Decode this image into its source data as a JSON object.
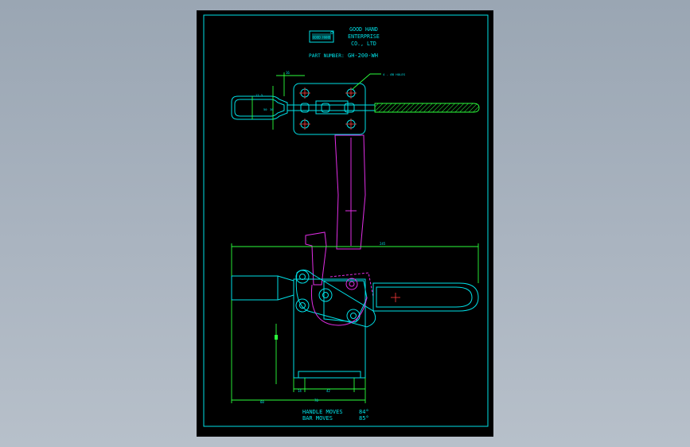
{
  "title_block": {
    "company_line1": "GOOD HAND",
    "company_line2": "ENTERPRISE",
    "company_line3": "CO., LTD",
    "part_number_label": "PART NUMBER:",
    "part_number_value": "GH-200-WH",
    "logo_text": "GOOD HAND"
  },
  "top_view": {
    "hole_callout": "4 - Ø8 HOLES",
    "dim_top": "16",
    "dim_left_a": "17.5",
    "dim_left_b": "30",
    "dim_left_c": "50"
  },
  "side_view": {
    "dim_overall": "245",
    "dim_bottom_left": "60",
    "dim_base_a": "14",
    "dim_base_b": "42",
    "dim_base_c": "70"
  },
  "notes": {
    "line1_label": "HANDLE  MOVES",
    "line1_value": "84°",
    "line2_label": "BAR       MOVES",
    "line2_value": "85°"
  },
  "colors": {
    "sheet_background": "#000000",
    "outline": "#00dfe6",
    "dimension": "#2bff3c",
    "linkage": "#e22ee6",
    "hatch": "#2bff3c"
  }
}
